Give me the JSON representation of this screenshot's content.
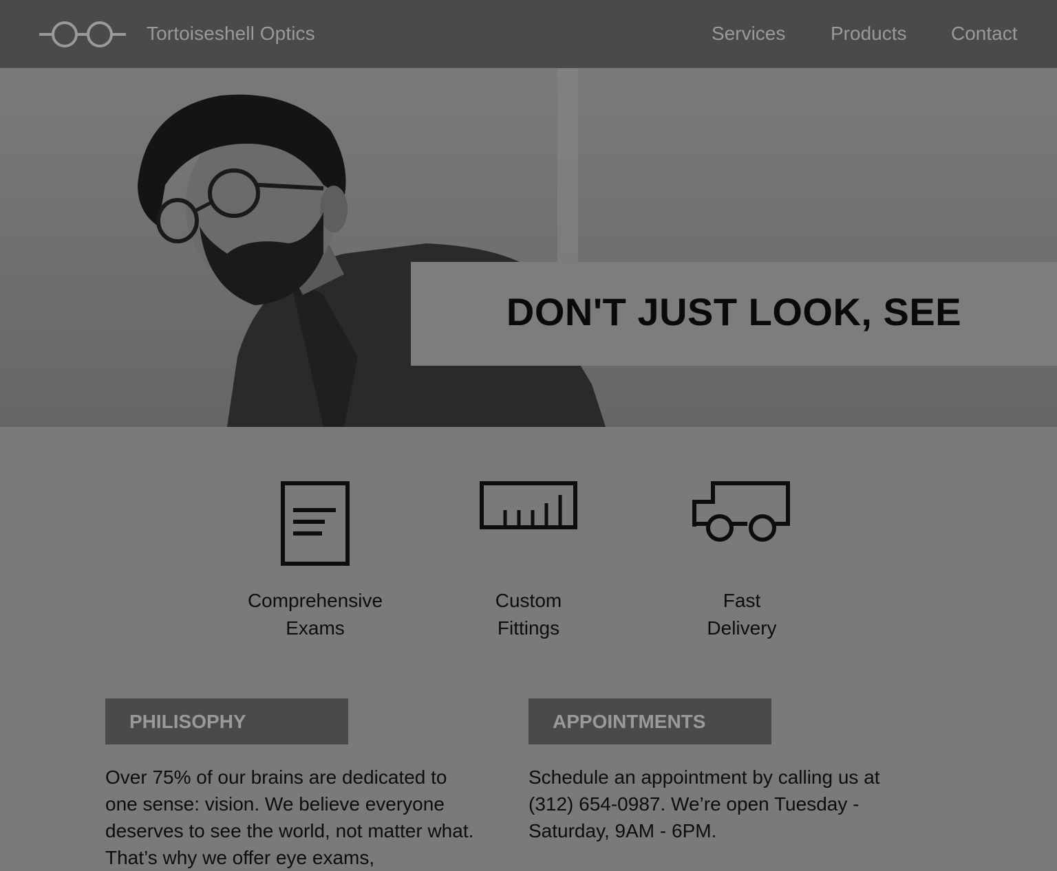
{
  "header": {
    "brand": "Tortoiseshell Optics",
    "logo_icon": "glasses-icon",
    "nav": [
      {
        "label": "Services"
      },
      {
        "label": "Products"
      },
      {
        "label": "Contact"
      }
    ]
  },
  "hero": {
    "tagline": "DON'T JUST LOOK, SEE"
  },
  "features": [
    {
      "icon": "document-icon",
      "line1": "Comprehensive",
      "line2": "Exams"
    },
    {
      "icon": "ruler-icon",
      "line1": "Custom",
      "line2": "Fittings"
    },
    {
      "icon": "truck-icon",
      "line1": "Fast",
      "line2": "Delivery"
    }
  ],
  "sections": [
    {
      "title": "PHILISOPHY",
      "body": "Over 75% of our brains are dedicated to one sense: vision. We believe everyone deserves to see the world, not matter what. That’s why we offer eye exams,"
    },
    {
      "title": "APPOINTMENTS",
      "body": "Schedule an appointment by calling us at (312) 654-0987. We’re open Tuesday - Saturday, 9AM - 6PM."
    }
  ],
  "colors": {
    "header_bg": "#4a4a4a",
    "page_bg": "#7a7a7a",
    "nav_text": "#9a9a9a",
    "text": "#0d0d0d"
  }
}
